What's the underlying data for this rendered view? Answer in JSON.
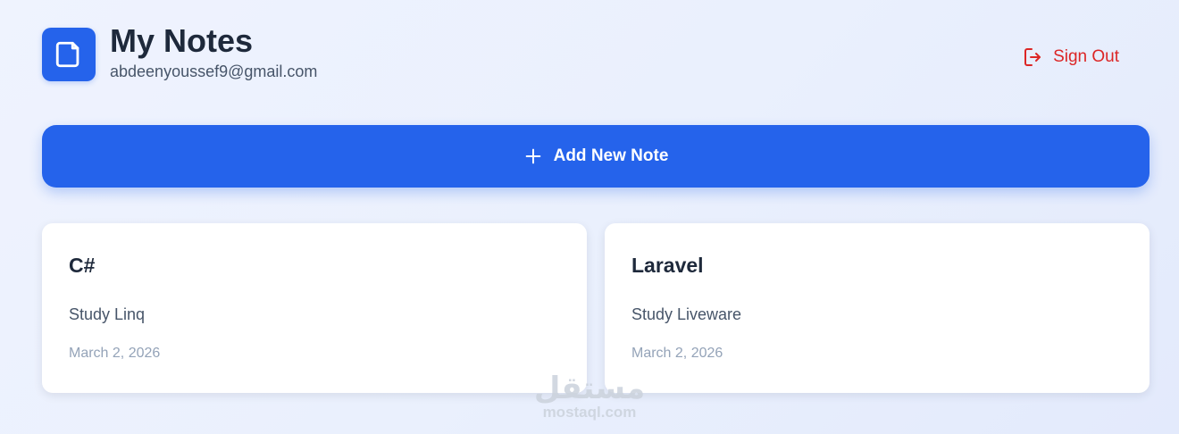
{
  "header": {
    "title": "My Notes",
    "email": "abdeenyoussef9@gmail.com",
    "logo_icon": "note-icon",
    "signout_label": "Sign Out",
    "signout_icon": "sign-out-icon"
  },
  "actions": {
    "add_label": "Add New Note",
    "add_icon": "plus-icon"
  },
  "notes": [
    {
      "title": "C#",
      "body": "Study Linq",
      "date": "March 2, 2026"
    },
    {
      "title": "Laravel",
      "body": "Study Liveware",
      "date": "March 2, 2026"
    }
  ],
  "watermark": {
    "arabic": "مستقل",
    "site": "mostaql.com"
  },
  "colors": {
    "primary": "#2563eb",
    "danger": "#dc2626",
    "text": "#1e293b",
    "muted": "#94a3b8"
  }
}
